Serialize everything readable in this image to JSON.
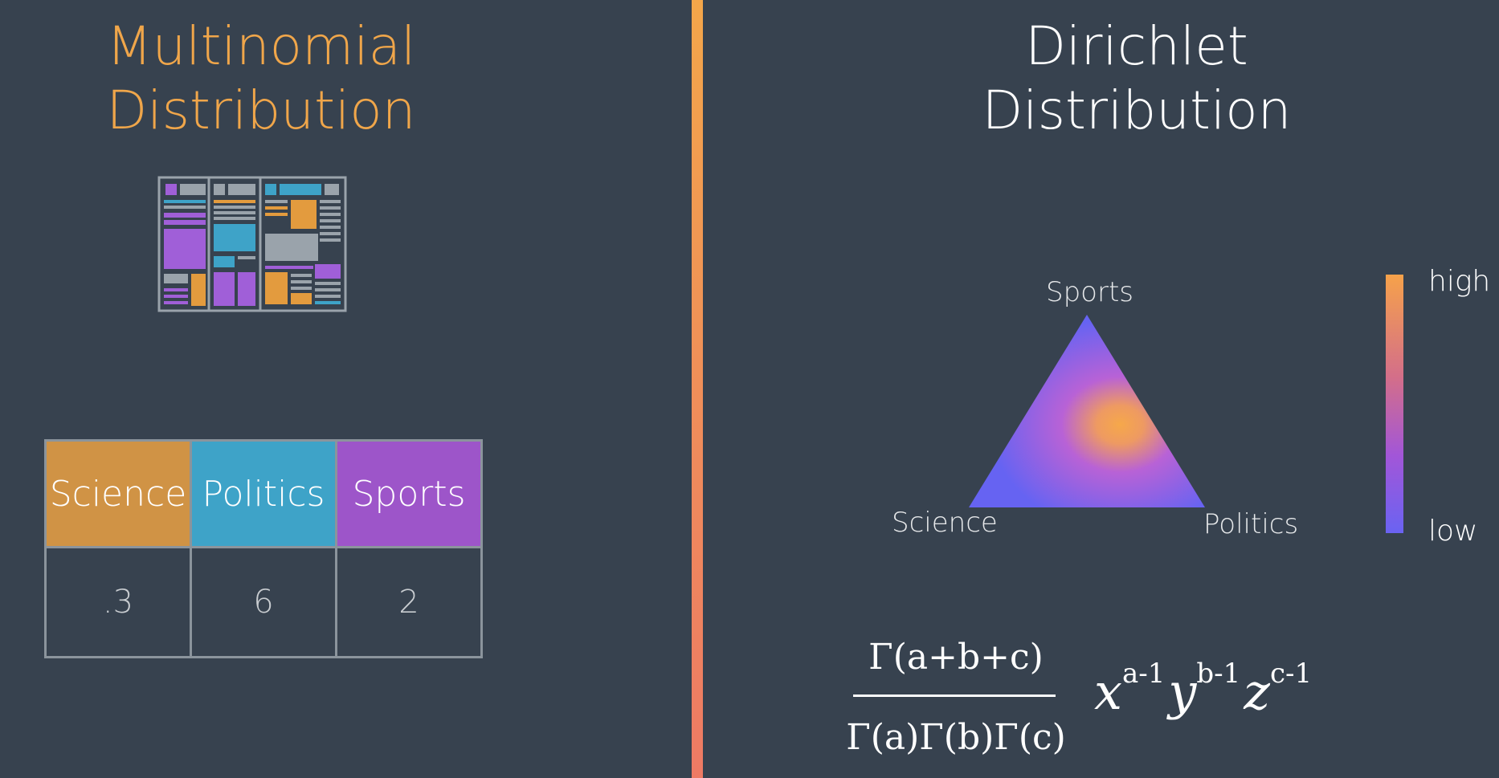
{
  "left_panel": {
    "title_line1": "Multinomial",
    "title_line2": "Distribution",
    "table": {
      "headers": [
        "Science",
        "Politics",
        "Sports"
      ],
      "values": [
        ".3",
        "6",
        "2"
      ]
    }
  },
  "right_panel": {
    "title_line1": "Dirichlet",
    "title_line2": "Distribution",
    "simplex": {
      "top_label": "Sports",
      "left_label": "Science",
      "right_label": "Politics"
    },
    "scale": {
      "high_label": "high",
      "low_label": "low"
    },
    "formula": {
      "numerator": "Γ(a+b+c)",
      "denominator": "Γ(a)Γ(b)Γ(c)",
      "x": "x",
      "x_exp": "a-1",
      "y": "y",
      "y_exp": "b-1",
      "z": "z",
      "z_exp": "c-1"
    }
  },
  "colors": {
    "background": "#37424f",
    "orange": "#f0a64a",
    "science": "#d09345",
    "politics": "#3ea3c8",
    "sports": "#9d55c9",
    "density_low": "#6a63f2",
    "density_high": "#f6a24a"
  }
}
